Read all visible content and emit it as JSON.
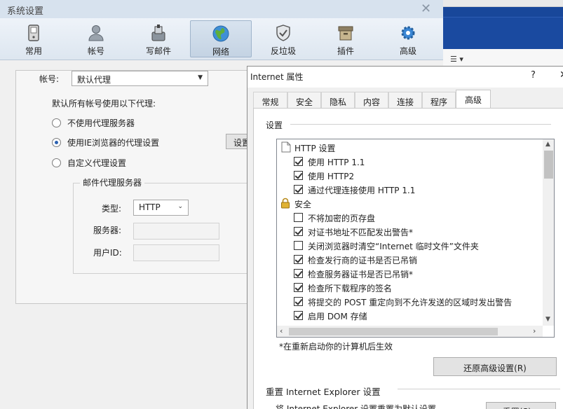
{
  "sys_window": {
    "title": "系统设置",
    "close": "✕",
    "toolbar": [
      {
        "label": "常用",
        "icon": "phone-icon"
      },
      {
        "label": "帐号",
        "icon": "user-icon"
      },
      {
        "label": "写邮件",
        "icon": "write-mail-icon"
      },
      {
        "label": "网络",
        "icon": "globe-icon",
        "active": true
      },
      {
        "label": "反垃圾",
        "icon": "shield-icon"
      },
      {
        "label": "插件",
        "icon": "plugin-box-icon"
      },
      {
        "label": "高级",
        "icon": "gear-icon"
      }
    ],
    "account_label": "帐号:",
    "account_value": "默认代理",
    "proxy_desc": "默认所有帐号使用以下代理:",
    "proxy_options": [
      {
        "label": "不使用代理服务器",
        "selected": false
      },
      {
        "label": "使用IE浏览器的代理设置",
        "selected": true
      },
      {
        "label": "自定义代理设置",
        "selected": false
      }
    ],
    "settings_button": "设置",
    "mail_proxy_group": "邮件代理服务器",
    "type_label": "类型:",
    "type_value": "HTTP",
    "server_label": "服务器:",
    "userid_label": "用户ID:"
  },
  "ie_dialog": {
    "title": "Internet 属性",
    "help": "?",
    "close": "✕",
    "tabs": [
      "常规",
      "安全",
      "隐私",
      "内容",
      "连接",
      "程序",
      "高级"
    ],
    "active_tab": "高级",
    "settings_label": "设置",
    "items": [
      {
        "type": "group",
        "text": "HTTP 设置",
        "icon": "document-icon"
      },
      {
        "type": "check",
        "text": "使用 HTTP 1.1",
        "checked": true
      },
      {
        "type": "check",
        "text": "使用 HTTP2",
        "checked": true
      },
      {
        "type": "check",
        "text": "通过代理连接使用 HTTP 1.1",
        "checked": true
      },
      {
        "type": "group",
        "text": "安全",
        "icon": "lock-icon"
      },
      {
        "type": "check",
        "text": "不将加密的页存盘",
        "checked": false
      },
      {
        "type": "check",
        "text": "对证书地址不匹配发出警告*",
        "checked": true
      },
      {
        "type": "check",
        "text": "关闭浏览器时清空“Internet 临时文件”文件夹",
        "checked": false
      },
      {
        "type": "check",
        "text": "检查发行商的证书是否已吊销",
        "checked": true
      },
      {
        "type": "check",
        "text": "检查服务器证书是否已吊销*",
        "checked": true
      },
      {
        "type": "check",
        "text": "检查所下载程序的签名",
        "checked": true
      },
      {
        "type": "check",
        "text": "将提交的 POST 重定向到不允许发送的区域时发出警告",
        "checked": true
      },
      {
        "type": "check",
        "text": "启用 DOM 存储",
        "checked": true
      }
    ],
    "restart_note": "*在重新启动你的计算机后生效",
    "restore_button": "还原高级设置(R)",
    "reset_section": "重置 Internet Explorer 设置",
    "reset_desc": "将 Internet Explorer 设置重置为默认设置。",
    "reset_button": "重置(S)..."
  }
}
